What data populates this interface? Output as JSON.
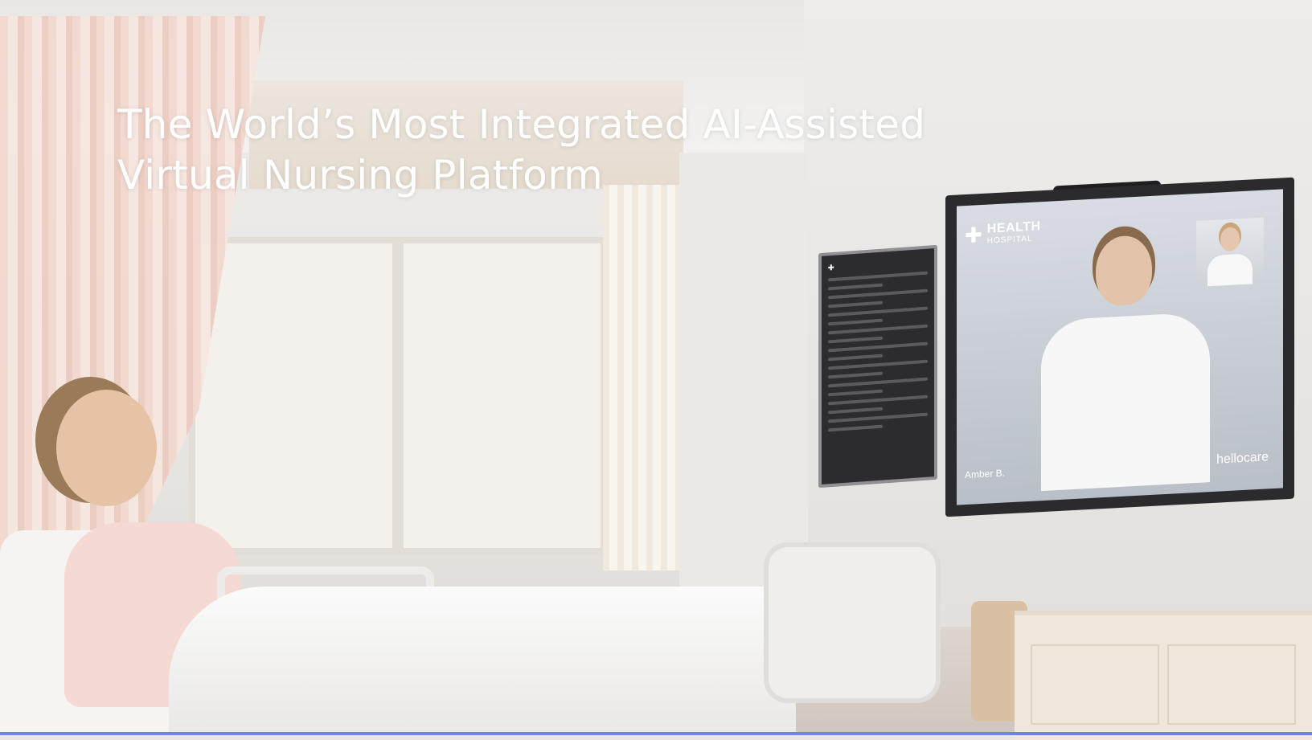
{
  "hero": {
    "headline_line1": "The World’s Most Integrated AI-Assisted",
    "headline_line2": "Virtual Nursing Platform"
  },
  "tv": {
    "hospital_name": "HEALTH",
    "hospital_sub": "HOSPITAL",
    "caller_name": "Amber B.",
    "brand": "hellocare"
  },
  "colors": {
    "accent_bar": "#6f86d6",
    "headline": "#ffffff"
  }
}
